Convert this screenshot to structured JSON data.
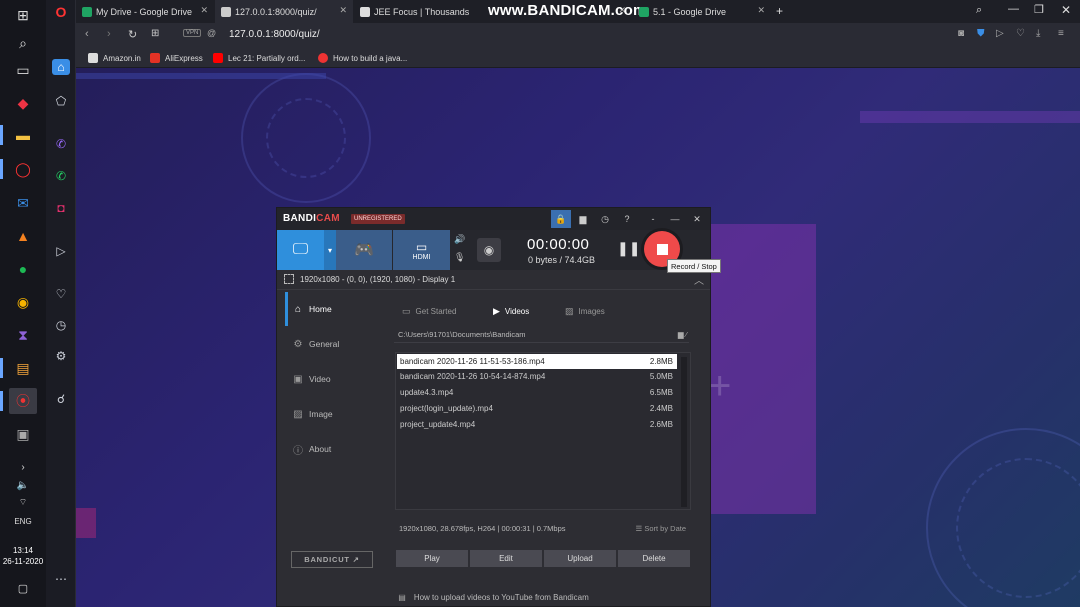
{
  "taskbar": {
    "lang": "ENG",
    "time": "13:14",
    "date": "26-11-2020"
  },
  "tabs": [
    {
      "label": "My Drive - Google Drive"
    },
    {
      "label": "127.0.0.1:8000/quiz/"
    },
    {
      "label": "JEE Focus | Thousands"
    },
    {
      "label": "5.1 - Google Drive"
    }
  ],
  "watermark": "www.BANDICAM.com",
  "address": {
    "url": "127.0.0.1:8000/quiz/",
    "vpn": "VPN"
  },
  "bookmarks": [
    {
      "label": "Amazon.in"
    },
    {
      "label": "AliExpress"
    },
    {
      "label": "Lec 21: Partially ord..."
    },
    {
      "label": "How to build a java..."
    }
  ],
  "bandicam": {
    "logo_main": "BANDI",
    "logo_accent": "CAM",
    "unregistered": "UNREGISTERED",
    "timer": "00:00:00",
    "bytes": "0 bytes / 74.4GB",
    "tooltip": "Record / Stop",
    "display_info": "1920x1080 - (0, 0), (1920, 1080) - Display 1",
    "hdmi": "HDMI",
    "side_items": [
      {
        "label": "Home"
      },
      {
        "label": "General"
      },
      {
        "label": "Video"
      },
      {
        "label": "Image"
      },
      {
        "label": "About"
      }
    ],
    "bandicut": "BANDICUT ↗",
    "subtabs": [
      {
        "label": "Get Started"
      },
      {
        "label": "Videos"
      },
      {
        "label": "Images"
      }
    ],
    "path": "C:\\Users\\91701\\Documents\\Bandicam",
    "files": [
      {
        "name": "bandicam 2020-11-26 11-51-53-186.mp4",
        "size": "2.8MB"
      },
      {
        "name": "bandicam 2020-11-26 10-54-14-874.mp4",
        "size": "5.0MB"
      },
      {
        "name": "update4.3.mp4",
        "size": "6.5MB"
      },
      {
        "name": "project(login_update).mp4",
        "size": "2.4MB"
      },
      {
        "name": "project_update4.mp4",
        "size": "2.6MB"
      }
    ],
    "file_info": "1920x1080, 28.678fps, H264 | 00:00:31 | 0.7Mbps",
    "sort_by": "Sort by Date",
    "actions": {
      "play": "Play",
      "edit": "Edit",
      "upload": "Upload",
      "delete": "Delete"
    },
    "footer": "How to upload videos to YouTube from Bandicam"
  },
  "colors": {
    "accent_blue": "#2f8fdc",
    "record_red": "#ef4a4a"
  }
}
